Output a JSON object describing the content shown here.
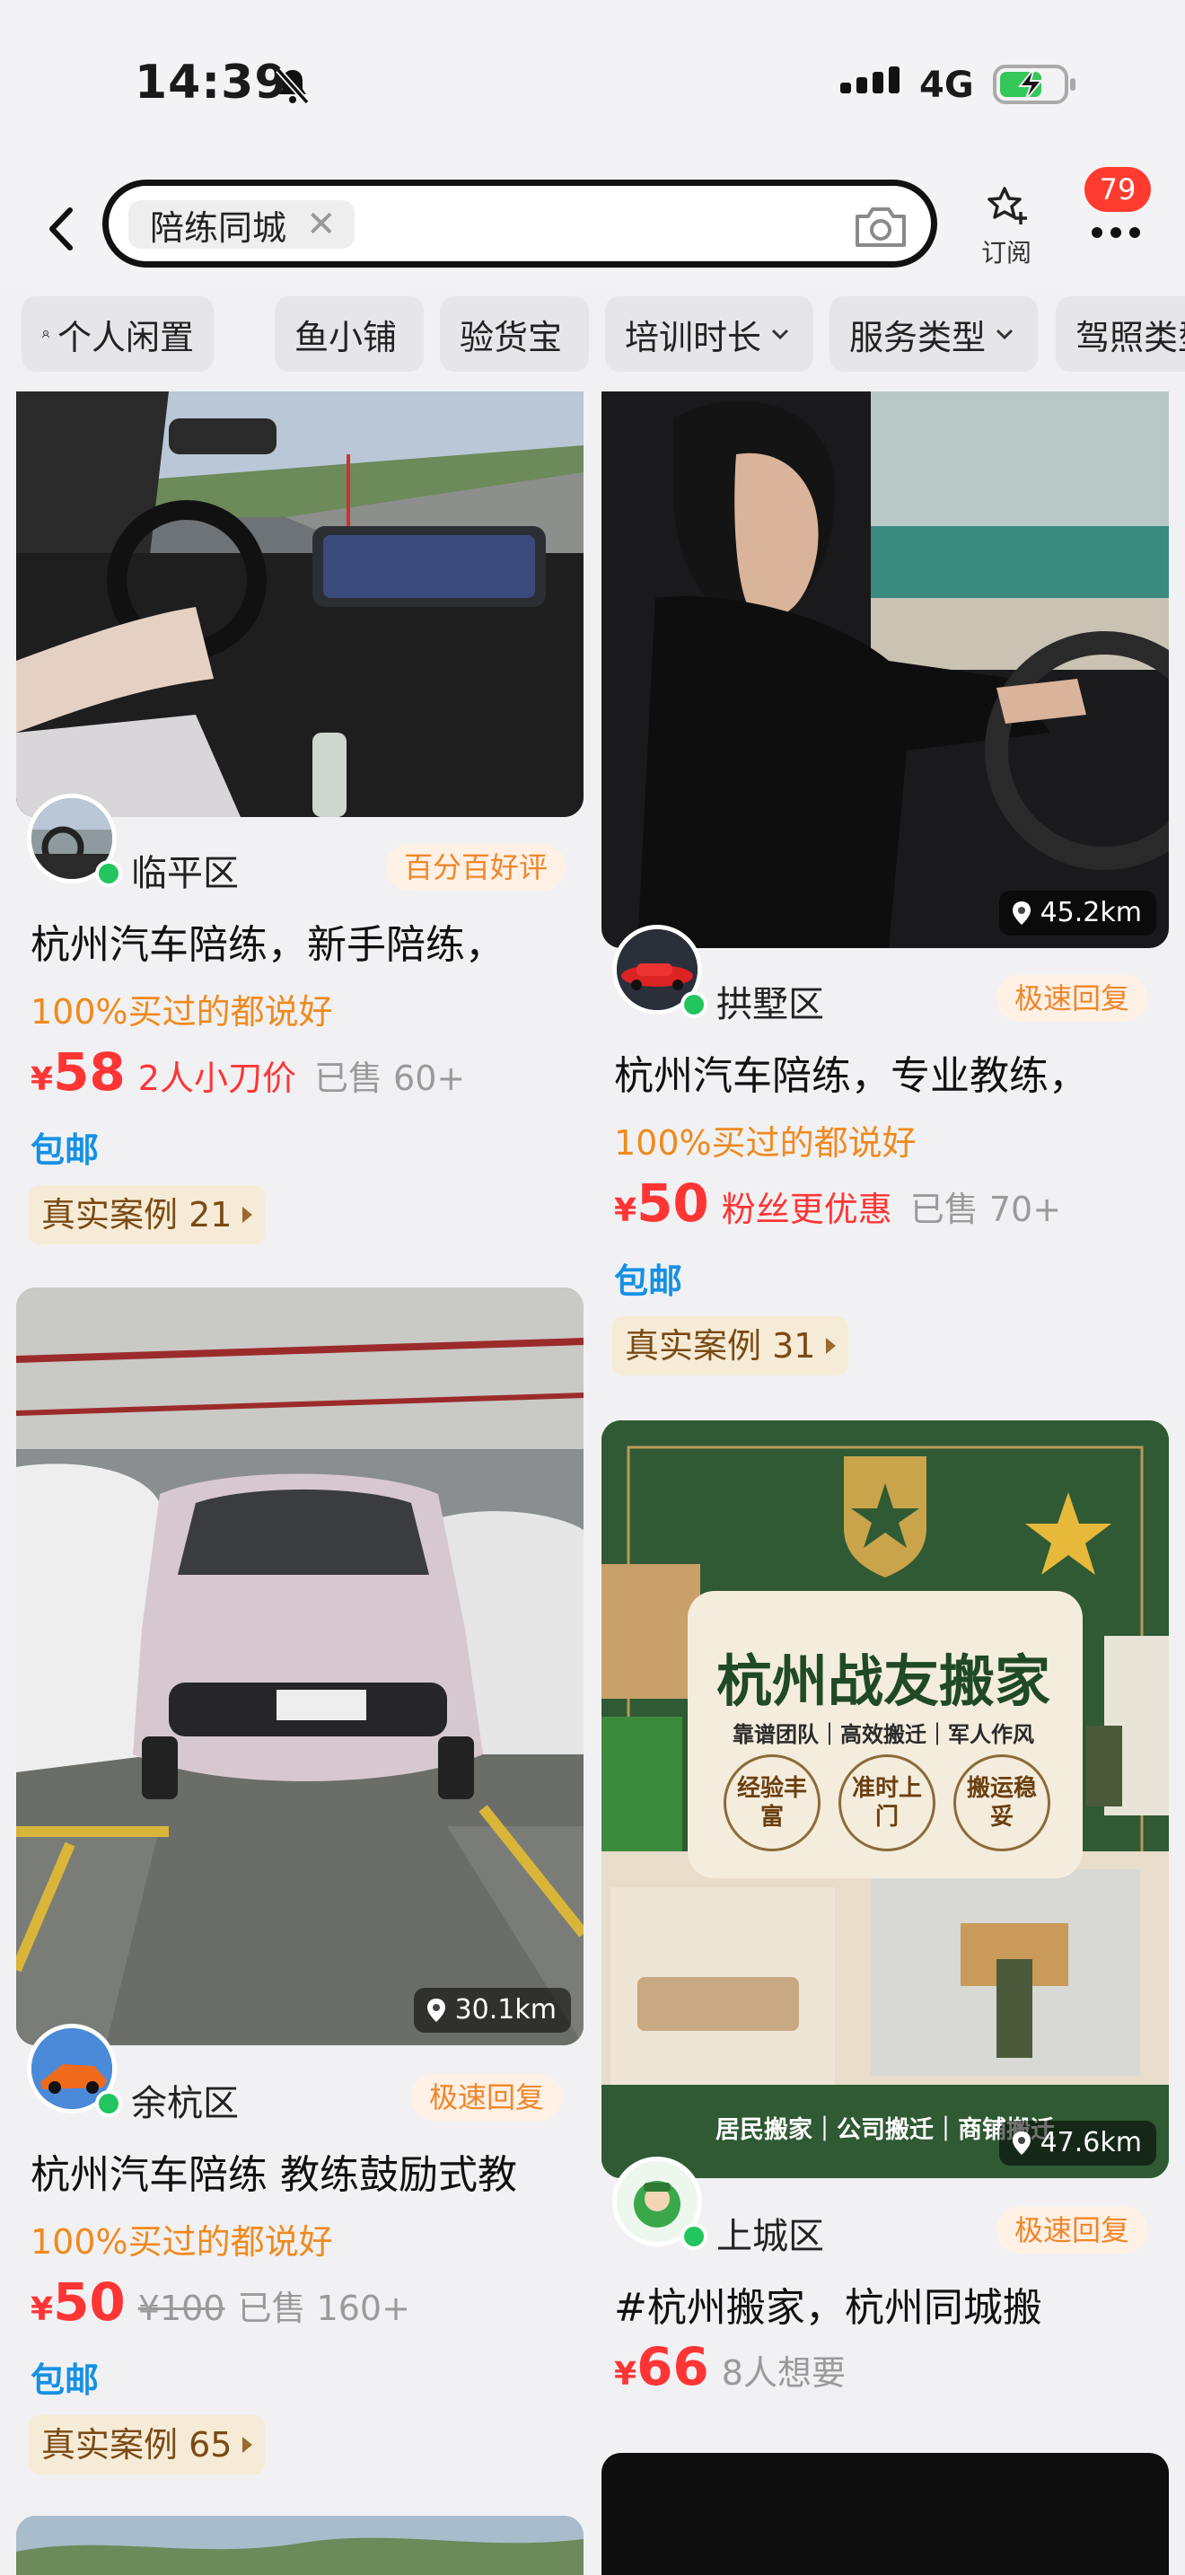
{
  "status_bar": {
    "time": "14:39",
    "network": "4G"
  },
  "search": {
    "query": "陪练同城",
    "subscribe_label": "订阅",
    "notification_count": "79"
  },
  "filters": [
    {
      "label": "个人闲置",
      "dropdown": false
    },
    {
      "label": "鱼小铺",
      "dropdown": false
    },
    {
      "label": "验货宝",
      "dropdown": false
    },
    {
      "label": "培训时长",
      "dropdown": true
    },
    {
      "label": "服务类型",
      "dropdown": true
    },
    {
      "label": "驾照类型",
      "dropdown": false
    }
  ],
  "listings": [
    {
      "area": "临平区",
      "tag": "百分百好评",
      "title": "杭州汽车陪练，新手陪练，",
      "rating_text": "100%买过的都说好",
      "currency": "¥",
      "price": "58",
      "price_note": "2人小刀价",
      "sold": "已售 60+",
      "shipping": "包邮",
      "cases": "真实案例 21"
    },
    {
      "area": "拱墅区",
      "tag": "极速回复",
      "distance": "45.2km",
      "title": "杭州汽车陪练，专业教练，",
      "rating_text": "100%买过的都说好",
      "currency": "¥",
      "price": "50",
      "price_note": "粉丝更优惠",
      "sold": "已售 70+",
      "shipping": "包邮",
      "cases": "真实案例 31"
    },
    {
      "area": "余杭区",
      "tag": "极速回复",
      "distance": "30.1km",
      "title": "杭州汽车陪练 教练鼓励式教",
      "rating_text": "100%买过的都说好",
      "currency": "¥",
      "price": "50",
      "original_price": "¥100",
      "sold": "已售 160+",
      "shipping": "包邮",
      "cases": "真实案例 65"
    },
    {
      "area": "上城区",
      "tag": "极速回复",
      "distance": "47.6km",
      "title": "#杭州搬家，杭州同城搬",
      "currency": "¥",
      "price": "66",
      "price_note": "8人想要",
      "poster": {
        "headline": "杭州战友搬家",
        "subline": "靠谱团队｜高效搬迁｜军人作风",
        "badges": [
          "经验丰富",
          "准时上门",
          "搬运稳妥"
        ],
        "footer": "居民搬家｜公司搬迁｜商铺搬迁"
      }
    }
  ],
  "colors": {
    "price_red": "#ff3535",
    "accent_orange": "#f0862a",
    "ship_blue": "#1591e3",
    "badge_red": "#ff3b30"
  }
}
